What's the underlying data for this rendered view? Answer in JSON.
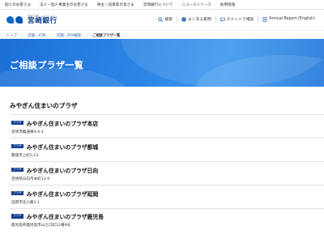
{
  "topnav": {
    "items": [
      "個人のお客さま",
      "法人・個人事業主のお客さま",
      "株主・投資家の皆さま",
      "宮崎銀行について",
      "ニュースリリース",
      "採用情報"
    ]
  },
  "header": {
    "logo_sub": "地元の夢。いっしょに。",
    "logo_name": "宮崎銀行",
    "search_label": "検索",
    "faq_label": "よくある質問",
    "chat_label": "チャットで相談",
    "annual_label": "Annual Report (English)"
  },
  "breadcrumb": {
    "items": [
      "トップ",
      "店舗・ATM",
      "店舗・ATM検索",
      "ご相談プラザ一覧"
    ]
  },
  "hero": {
    "title": "ご相談プラザ一覧"
  },
  "section": {
    "title": "みやぎん住まいのプラザ"
  },
  "plazas": [
    {
      "tag": "プラザ",
      "name": "みやぎん住まいのプラザ本店",
      "address": "宮崎市橘通東4-4-3"
    },
    {
      "tag": "プラザ",
      "name": "みやぎん住まいのプラザ都城",
      "address": "都城市上町5-13"
    },
    {
      "tag": "プラザ",
      "name": "みやぎん住まいのプラザ日向",
      "address": "宮崎県日向市本町13-9"
    },
    {
      "tag": "プラザ",
      "name": "みやぎん住まいのプラザ延岡",
      "address": "延岡市北小路1-1"
    },
    {
      "tag": "プラザ",
      "name": "みやぎん住まいのプラザ鹿児島",
      "address": "鹿児島県鹿児島市山之口町12番9号"
    }
  ],
  "colors": {
    "brand": "#103f91",
    "hero": "#2d86e6",
    "link": "#2b5ea8"
  },
  "icons": {
    "search": "search-icon",
    "faq": "question-icon",
    "chat": "chat-icon",
    "annual": "document-icon"
  }
}
